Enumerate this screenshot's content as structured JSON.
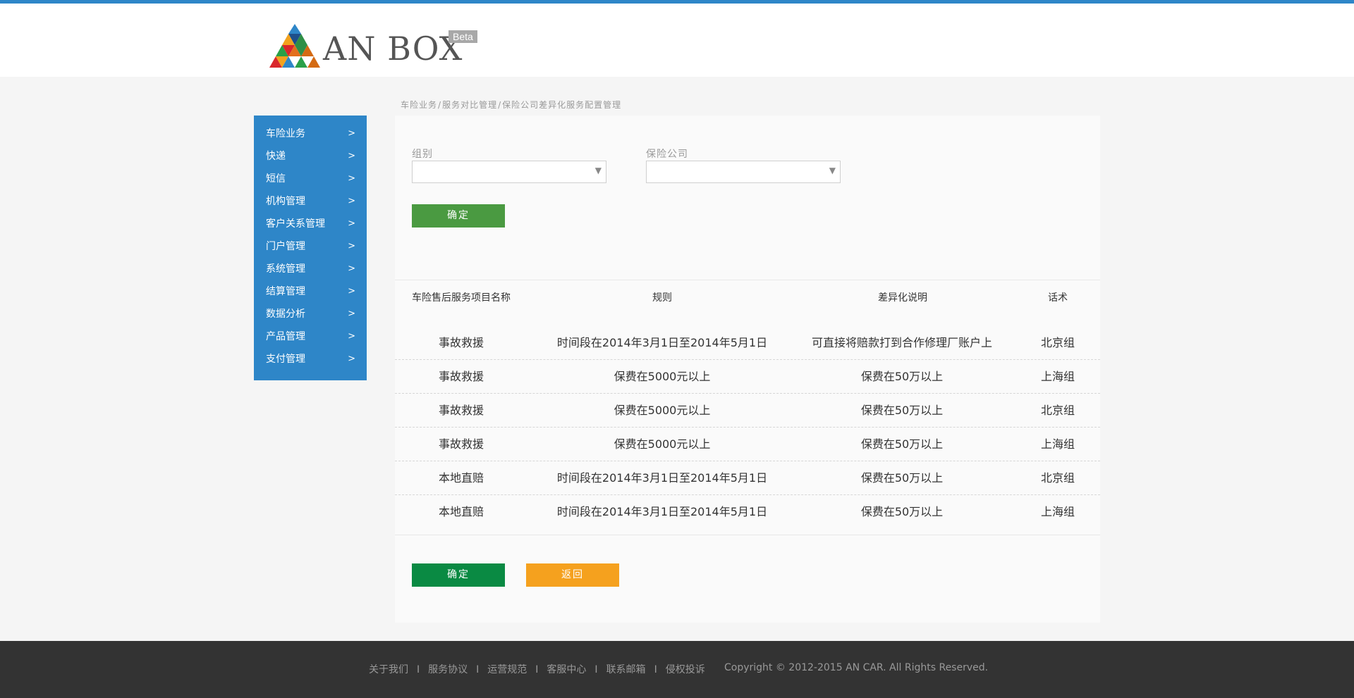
{
  "brand": {
    "name": "AN BOX",
    "badge": "Beta",
    "logo_colors": [
      "#2e86c8",
      "#1e4f8a",
      "#f2a21e",
      "#2f8f46",
      "#d9262b",
      "#2aa048",
      "#d46a12"
    ]
  },
  "colors": {
    "accent": "#2e86c8",
    "confirm_green": "#0a8a43",
    "back_orange": "#f5a11e",
    "footer_bg": "#333333"
  },
  "sidebar": {
    "items": [
      {
        "label": "车险业务",
        "chevron": ">"
      },
      {
        "label": "快递",
        "chevron": ">"
      },
      {
        "label": "短信",
        "chevron": ">"
      },
      {
        "label": "机构管理",
        "chevron": ">"
      },
      {
        "label": "客户关系管理",
        "chevron": ">"
      },
      {
        "label": "门户管理",
        "chevron": ">"
      },
      {
        "label": "系统管理",
        "chevron": ">"
      },
      {
        "label": "结算管理",
        "chevron": ">"
      },
      {
        "label": "数据分析",
        "chevron": ">"
      },
      {
        "label": "产品管理",
        "chevron": ">"
      },
      {
        "label": "支付管理",
        "chevron": ">"
      }
    ]
  },
  "breadcrumb": [
    "车险业务",
    "服务对比管理",
    "保险公司差异化服务配置管理"
  ],
  "breadcrumb_sep": "/",
  "filters": {
    "group_label": "组别",
    "group_value": "",
    "insurer_label": "保险公司",
    "insurer_value": "",
    "confirm": "确定"
  },
  "table": {
    "headers": [
      "车险售后服务项目名称",
      "规则",
      "差异化说明",
      "话术"
    ],
    "rows": [
      [
        "事故救援",
        "时间段在2014年3月1日至2014年5月1日",
        "可直接将赔款打到合作修理厂账户上",
        "北京组"
      ],
      [
        "事故救援",
        "保费在5000元以上",
        "保费在50万以上",
        "上海组"
      ],
      [
        "事故救援",
        "保费在5000元以上",
        "保费在50万以上",
        "北京组"
      ],
      [
        "事故救援",
        "保费在5000元以上",
        "保费在50万以上",
        "上海组"
      ],
      [
        "本地直赔",
        "时间段在2014年3月1日至2014年5月1日",
        "保费在50万以上",
        "北京组"
      ],
      [
        "本地直赔",
        "时间段在2014年3月1日至2014年5月1日",
        "保费在50万以上",
        "上海组"
      ]
    ]
  },
  "actions": {
    "confirm": "确定",
    "back": "返回"
  },
  "footer": {
    "links": [
      "关于我们",
      "服务协议",
      "运营规范",
      "客服中心",
      "联系邮箱",
      "侵权投诉"
    ],
    "separator": "I",
    "copyright": "Copyright © 2012-2015 AN CAR.  All Rights Reserved."
  }
}
